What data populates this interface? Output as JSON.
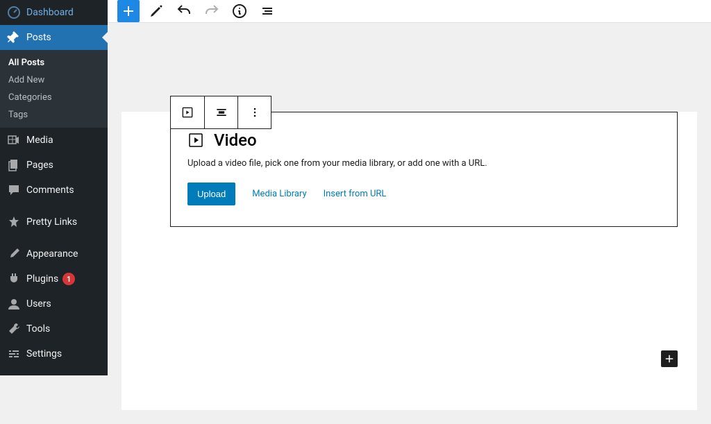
{
  "sidebar": {
    "dashboard": "Dashboard",
    "posts": "Posts",
    "posts_sub": [
      "All Posts",
      "Add New",
      "Categories",
      "Tags"
    ],
    "media": "Media",
    "pages": "Pages",
    "comments": "Comments",
    "pretty_links": "Pretty Links",
    "appearance": "Appearance",
    "plugins": "Plugins",
    "plugins_badge": "1",
    "users": "Users",
    "tools": "Tools",
    "settings": "Settings"
  },
  "block": {
    "title": "Video",
    "description": "Upload a video file, pick one from your media library, or add one with a URL.",
    "upload": "Upload",
    "media_library": "Media Library",
    "insert_url": "Insert from URL"
  }
}
